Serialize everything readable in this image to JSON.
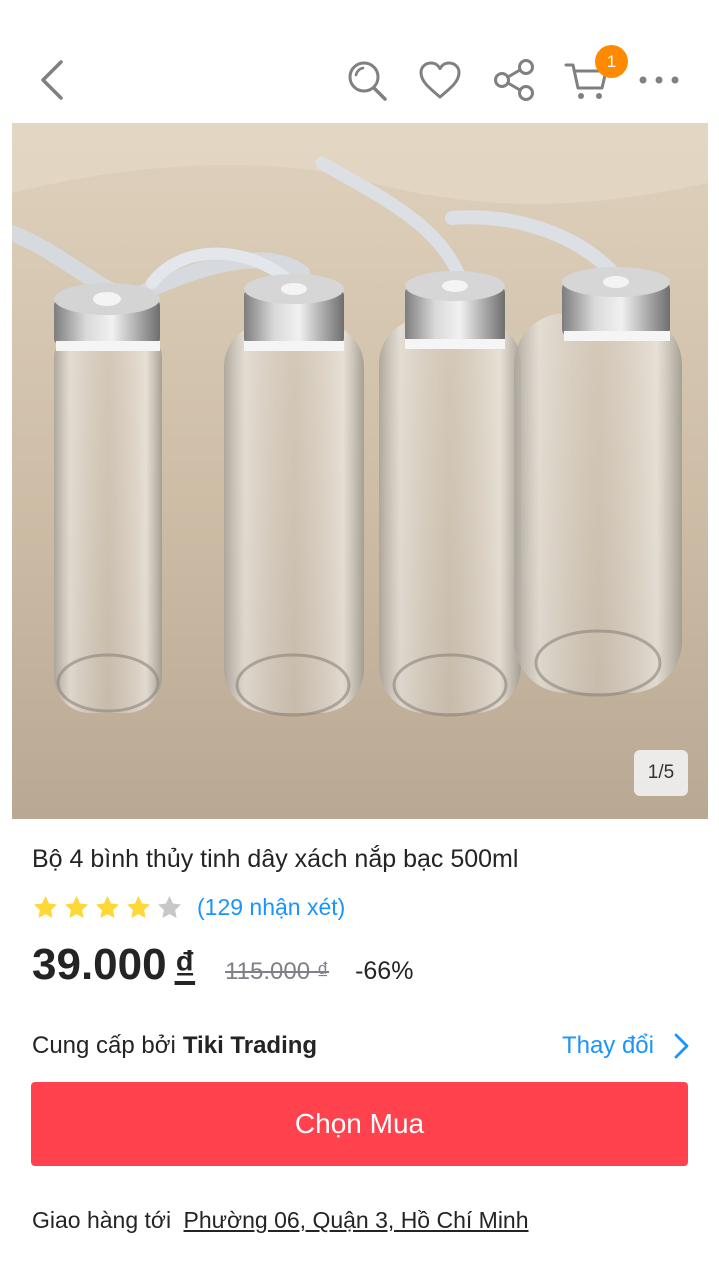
{
  "header": {
    "cart_count": "1"
  },
  "gallery": {
    "counter": "1/5"
  },
  "product": {
    "title": "Bộ 4 bình thủy tinh dây xách nắp bạc 500ml",
    "rating": 4,
    "rating_max": 5,
    "review_count_label": "(129 nhận xét)",
    "price": "39.000",
    "currency": "₫",
    "old_price": "115.000 ₫",
    "discount": "-66%"
  },
  "seller": {
    "prefix": "Cung cấp bởi",
    "name": "Tiki Trading",
    "change_label": "Thay đổi"
  },
  "buy_button_label": "Chọn Mua",
  "delivery": {
    "prefix": "Giao hàng tới",
    "address": "Phường 06, Quận 3, Hồ Chí Minh"
  },
  "colors": {
    "accent_blue": "#1a94ff",
    "buy_red": "#ff424e",
    "badge_orange": "#ff8a00",
    "star_yellow": "#fdd836",
    "star_gray": "#c7c7c7"
  }
}
